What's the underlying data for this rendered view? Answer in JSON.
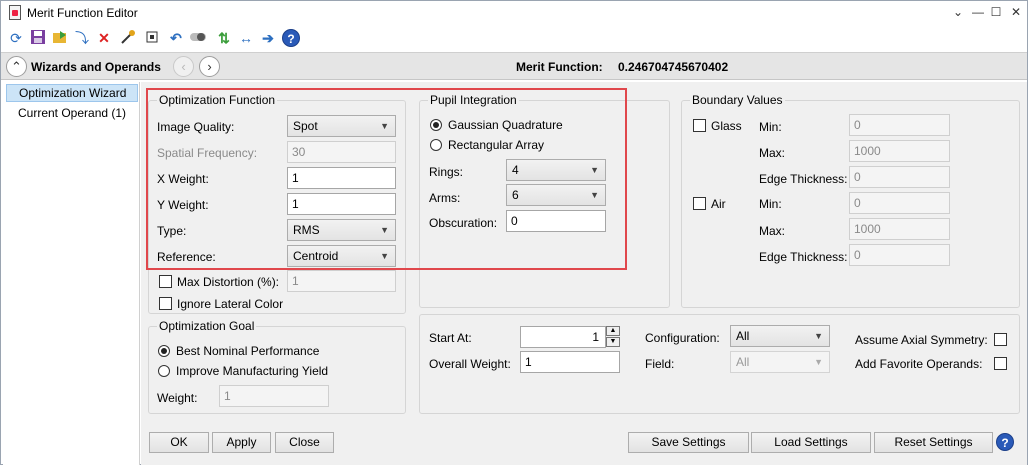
{
  "window": {
    "title": "Merit Function Editor"
  },
  "title_buttons": {
    "chevron": "⌄",
    "minimize": "—",
    "maximize": "☐",
    "close": "✕"
  },
  "toolbar": {
    "icons": [
      "refresh-icon",
      "save-icon",
      "load-icon",
      "insert-arrow-icon",
      "delete-icon",
      "wand-icon",
      "square-icon",
      "undo-icon",
      "toggle-icon",
      "swap-icon",
      "arrows-icon",
      "right-arrow-icon",
      "help-icon"
    ]
  },
  "nav": {
    "title": "Wizards and Operands",
    "back": "‹",
    "forward": "›",
    "merit_label": "Merit Function:",
    "merit_value": "0.246704745670402"
  },
  "sidebar": {
    "items": [
      {
        "label": "Optimization Wizard",
        "selected": true
      },
      {
        "label": "Current Operand (1)",
        "selected": false
      }
    ]
  },
  "optimization_function": {
    "title": "Optimization Function",
    "image_quality_label": "Image Quality:",
    "image_quality_value": "Spot",
    "spatial_freq_label": "Spatial Frequency:",
    "spatial_freq_value": "30",
    "x_weight_label": "X Weight:",
    "x_weight_value": "1",
    "y_weight_label": "Y Weight:",
    "y_weight_value": "1",
    "type_label": "Type:",
    "type_value": "RMS",
    "reference_label": "Reference:",
    "reference_value": "Centroid",
    "max_distortion_label": "Max Distortion (%):",
    "max_distortion_value": "1",
    "ignore_lateral_label": "Ignore Lateral Color"
  },
  "pupil_integration": {
    "title": "Pupil Integration",
    "gaussian_label": "Gaussian Quadrature",
    "rectangular_label": "Rectangular Array",
    "rings_label": "Rings:",
    "rings_value": "4",
    "arms_label": "Arms:",
    "arms_value": "6",
    "obscuration_label": "Obscuration:",
    "obscuration_value": "0"
  },
  "boundary_values": {
    "title": "Boundary Values",
    "glass_label": "Glass",
    "air_label": "Air",
    "min_label": "Min:",
    "max_label": "Max:",
    "edge_label": "Edge Thickness:",
    "glass_min": "0",
    "glass_max": "1000",
    "glass_edge": "0",
    "air_min": "0",
    "air_max": "1000",
    "air_edge": "0"
  },
  "optimization_goal": {
    "title": "Optimization Goal",
    "best_nominal_label": "Best Nominal Performance",
    "improve_yield_label": "Improve Manufacturing Yield",
    "weight_label": "Weight:",
    "weight_value": "1"
  },
  "settings": {
    "start_at_label": "Start At:",
    "start_at_value": "1",
    "overall_weight_label": "Overall Weight:",
    "overall_weight_value": "1",
    "configuration_label": "Configuration:",
    "configuration_value": "All",
    "field_label": "Field:",
    "field_value": "All",
    "assume_axial_label": "Assume Axial Symmetry:",
    "add_favorite_label": "Add Favorite Operands:"
  },
  "buttons": {
    "ok": "OK",
    "apply": "Apply",
    "close": "Close",
    "save_settings": "Save Settings",
    "load_settings": "Load Settings",
    "reset_settings": "Reset Settings",
    "help": "?"
  },
  "colors": {
    "highlight_frame": "#e0474c",
    "selection": "#cce4f7",
    "panel": "#f0f0f0"
  }
}
